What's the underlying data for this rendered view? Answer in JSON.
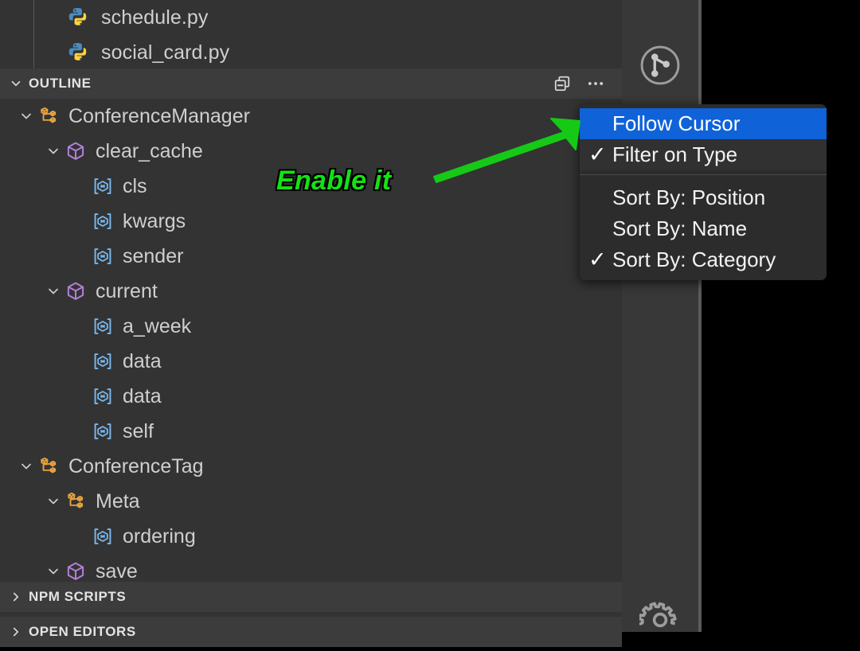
{
  "window": {
    "theme": "vscode-dark",
    "colors": {
      "sidebar_bg": "#333333",
      "section_header_bg": "#3c3c3c",
      "activity_bar_bg": "#383838",
      "menu_bg": "#2c2c2c",
      "menu_selected_bg": "#0f62d8",
      "text": "#cfcfcf",
      "class_icon": "#e8a33d",
      "method_icon": "#b180d7",
      "variable_icon": "#78b8f0",
      "annotation_green": "#16e016"
    }
  },
  "explorer": {
    "files": [
      {
        "label": "schedule.py",
        "icon": "python-file-icon"
      },
      {
        "label": "social_card.py",
        "icon": "python-file-icon"
      }
    ]
  },
  "sections": {
    "outline": {
      "title": "OUTLINE",
      "expanded": true,
      "twisty_icon": "chevron-down-icon",
      "actions": [
        {
          "name": "collapse-all-icon",
          "tooltip": "Collapse All"
        },
        {
          "name": "more-actions-icon",
          "tooltip": "Views and More Actions..."
        }
      ]
    },
    "npm_scripts": {
      "title": "NPM SCRIPTS",
      "expanded": false,
      "twisty_icon": "chevron-right-icon"
    },
    "open_editors": {
      "title": "OPEN EDITORS",
      "expanded": false,
      "twisty_icon": "chevron-right-icon"
    }
  },
  "outline_tree": [
    {
      "label": "ConferenceManager",
      "kind": "class",
      "icon": "symbol-class-icon",
      "indent": 0,
      "twisty": "chevron-down-icon",
      "expanded": true
    },
    {
      "label": "clear_cache",
      "kind": "method",
      "icon": "symbol-method-icon",
      "indent": 1,
      "twisty": "chevron-down-icon",
      "expanded": true
    },
    {
      "label": "cls",
      "kind": "variable",
      "icon": "symbol-variable-icon",
      "indent": 2,
      "twisty": null,
      "expanded": false
    },
    {
      "label": "kwargs",
      "kind": "variable",
      "icon": "symbol-variable-icon",
      "indent": 2,
      "twisty": null,
      "expanded": false
    },
    {
      "label": "sender",
      "kind": "variable",
      "icon": "symbol-variable-icon",
      "indent": 2,
      "twisty": null,
      "expanded": false
    },
    {
      "label": "current",
      "kind": "method",
      "icon": "symbol-method-icon",
      "indent": 1,
      "twisty": "chevron-down-icon",
      "expanded": true
    },
    {
      "label": "a_week",
      "kind": "variable",
      "icon": "symbol-variable-icon",
      "indent": 2,
      "twisty": null,
      "expanded": false
    },
    {
      "label": "data",
      "kind": "variable",
      "icon": "symbol-variable-icon",
      "indent": 2,
      "twisty": null,
      "expanded": false
    },
    {
      "label": "data",
      "kind": "variable",
      "icon": "symbol-variable-icon",
      "indent": 2,
      "twisty": null,
      "expanded": false
    },
    {
      "label": "self",
      "kind": "variable",
      "icon": "symbol-variable-icon",
      "indent": 2,
      "twisty": null,
      "expanded": false
    },
    {
      "label": "ConferenceTag",
      "kind": "class",
      "icon": "symbol-class-icon",
      "indent": 0,
      "twisty": "chevron-down-icon",
      "expanded": true
    },
    {
      "label": "Meta",
      "kind": "class",
      "icon": "symbol-class-icon",
      "indent": 1,
      "twisty": "chevron-down-icon",
      "expanded": true
    },
    {
      "label": "ordering",
      "kind": "variable",
      "icon": "symbol-variable-icon",
      "indent": 2,
      "twisty": null,
      "expanded": false
    },
    {
      "label": "save",
      "kind": "method",
      "icon": "symbol-method-icon",
      "indent": 1,
      "twisty": "chevron-down-icon",
      "expanded": true
    }
  ],
  "context_menu": {
    "groups": [
      {
        "items": [
          {
            "label": "Follow Cursor",
            "checked": false,
            "selected": true
          },
          {
            "label": "Filter on Type",
            "checked": true,
            "selected": false
          }
        ]
      },
      {
        "items": [
          {
            "label": "Sort By: Position",
            "checked": false,
            "selected": false
          },
          {
            "label": "Sort By: Name",
            "checked": false,
            "selected": false
          },
          {
            "label": "Sort By: Category",
            "checked": true,
            "selected": false
          }
        ]
      }
    ],
    "check_glyph": "✓"
  },
  "activity_bar": {
    "items": [
      {
        "name": "source-control-icon",
        "badge": null
      },
      {
        "name": "manage-gear-icon",
        "badge": null
      }
    ]
  },
  "annotations": {
    "callout_text": "Enable it",
    "arrow": {
      "name": "green-arrow",
      "direction": "up-right"
    }
  }
}
